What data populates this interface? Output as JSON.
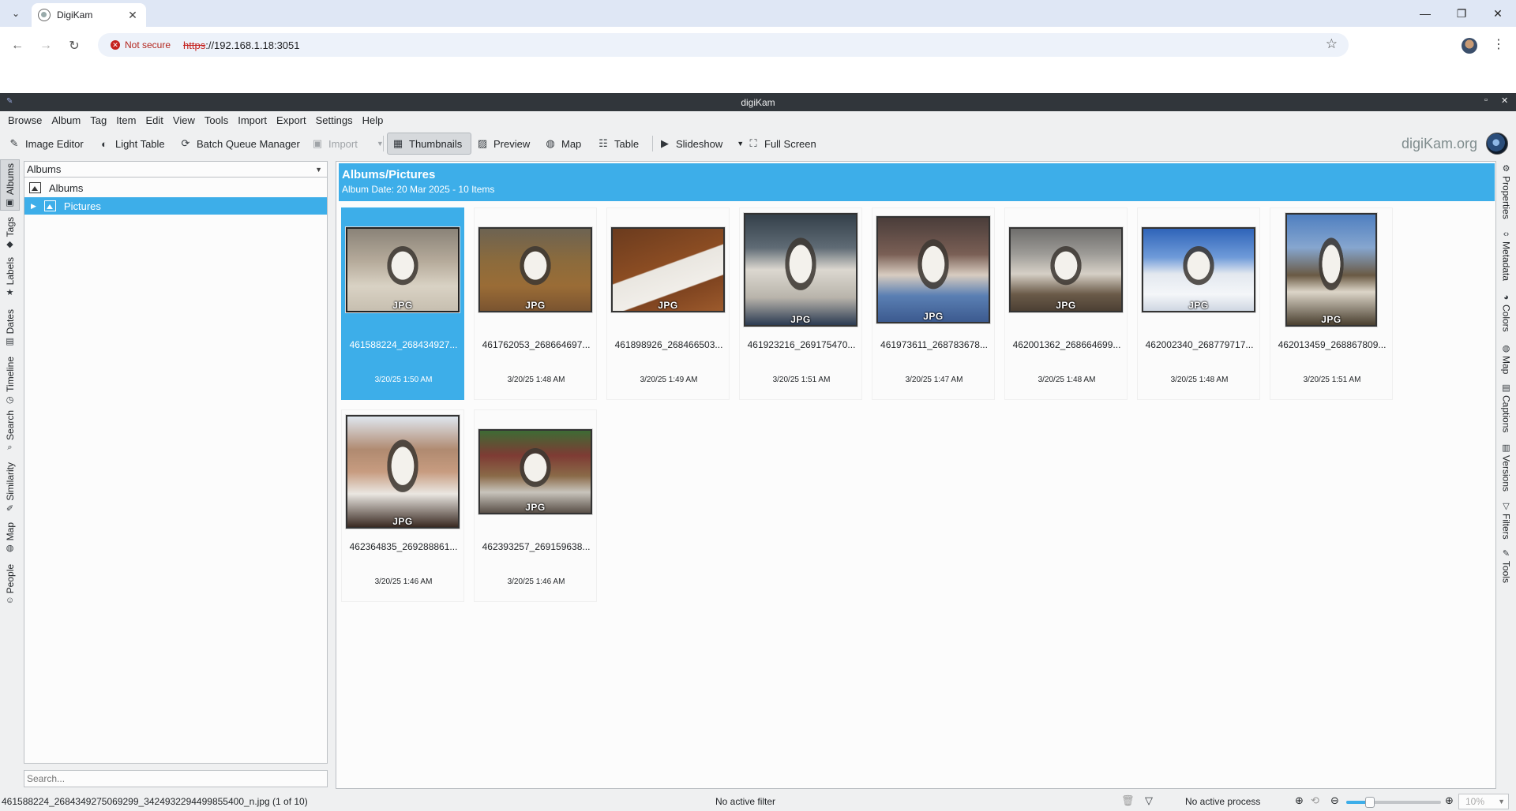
{
  "browser": {
    "tab_title": "DigiKam",
    "not_secure": "Not secure",
    "url_scheme": "https",
    "url_rest": "://192.168.1.18:3051"
  },
  "app": {
    "window_title": "digiKam",
    "logo_text": "digiKam.org"
  },
  "menu": [
    "Browse",
    "Album",
    "Tag",
    "Item",
    "Edit",
    "View",
    "Tools",
    "Import",
    "Export",
    "Settings",
    "Help"
  ],
  "toolbar": {
    "image_editor": "Image Editor",
    "light_table": "Light Table",
    "batch_queue": "Batch Queue Manager",
    "import": "Import",
    "thumbnails": "Thumbnails",
    "preview": "Preview",
    "map": "Map",
    "table": "Table",
    "slideshow": "Slideshow",
    "full_screen": "Full Screen"
  },
  "left_tabs": [
    "Albums",
    "Tags",
    "Labels",
    "Dates",
    "Timeline",
    "Search",
    "Similarity",
    "Map",
    "People"
  ],
  "right_tabs": [
    "Properties",
    "Metadata",
    "Colors",
    "Map",
    "Captions",
    "Versions",
    "Filters",
    "Tools"
  ],
  "album_panel": {
    "combo": "Albums",
    "root": "Albums",
    "child": "Pictures",
    "search_placeholder": "Search..."
  },
  "main": {
    "title": "Albums/Pictures",
    "subtitle": "Album Date: 20 Mar 2025 - 10 Items",
    "format_label": "JPG",
    "thumbnails": [
      {
        "name": "461588224_268434927...",
        "date": "3/20/25 1:50 AM",
        "selected": true
      },
      {
        "name": "461762053_268664697...",
        "date": "3/20/25 1:48 AM"
      },
      {
        "name": "461898926_268466503...",
        "date": "3/20/25 1:49 AM"
      },
      {
        "name": "461923216_269175470...",
        "date": "3/20/25 1:51 AM"
      },
      {
        "name": "461973611_268783678...",
        "date": "3/20/25 1:47 AM"
      },
      {
        "name": "462001362_268664699...",
        "date": "3/20/25 1:48 AM"
      },
      {
        "name": "462002340_268779717...",
        "date": "3/20/25 1:48 AM"
      },
      {
        "name": "462013459_268867809...",
        "date": "3/20/25 1:51 AM"
      },
      {
        "name": "462364835_269288861...",
        "date": "3/20/25 1:46 AM"
      },
      {
        "name": "462393257_269159638...",
        "date": "3/20/25 1:46 AM"
      }
    ]
  },
  "status": {
    "file": "461588224_2684349275069299_3424932294499855400_n.jpg (1 of 10)",
    "filter": "No active filter",
    "process": "No active process",
    "zoom": "10%",
    "zoom_level": 0.25
  },
  "colors": {
    "accent": "#3daee9",
    "titlebar": "#31363b"
  }
}
